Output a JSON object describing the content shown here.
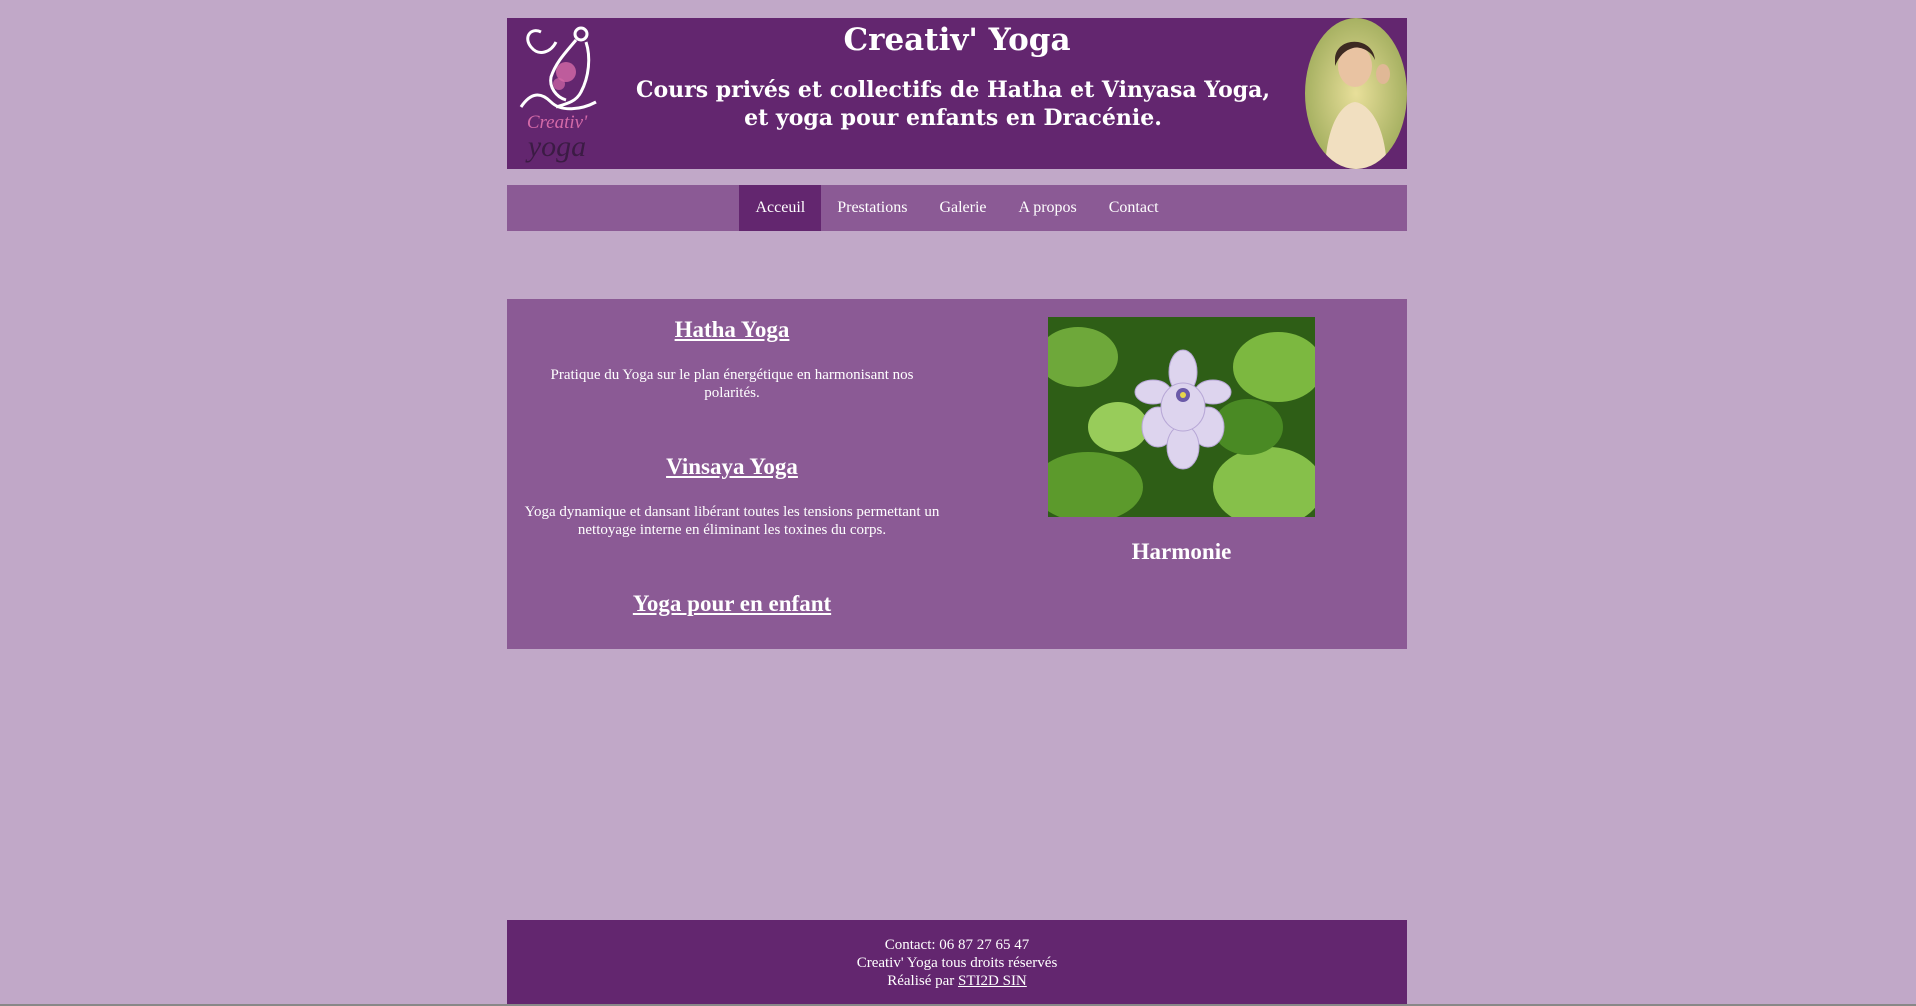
{
  "header": {
    "logo_text_1": "Creativ'",
    "logo_text_2": "yoga",
    "title": "Creativ' Yoga",
    "subtitle": "Cours privés et collectifs de Hatha et Vinyasa Yoga, et yoga pour enfants en Dracénie."
  },
  "nav": {
    "items": [
      {
        "label": "Acceuil",
        "active": true
      },
      {
        "label": "Prestations"
      },
      {
        "label": "Galerie"
      },
      {
        "label": "A propos"
      },
      {
        "label": "Contact"
      }
    ]
  },
  "main": {
    "sections": [
      {
        "title": "Hatha Yoga",
        "text": "Pratique du Yoga sur le plan énergétique en harmonisant nos polarités."
      },
      {
        "title": "Vinsaya Yoga",
        "text": "Yoga dynamique et dansant libérant toutes les tensions permettant un nettoyage interne en éliminant les toxines du corps."
      },
      {
        "title": "Yoga pour en enfant"
      }
    ],
    "image_caption": "Harmonie"
  },
  "footer": {
    "contact": "Contact: 06 87 27 65 47",
    "rights": "Creativ' Yoga tous droits réservés",
    "made_by_prefix": "Réalisé par",
    "made_by_link": "STI2D SIN"
  },
  "colors": {
    "background": "#c1a8c8",
    "header": "#63266f",
    "panel": "#8b5a95"
  }
}
